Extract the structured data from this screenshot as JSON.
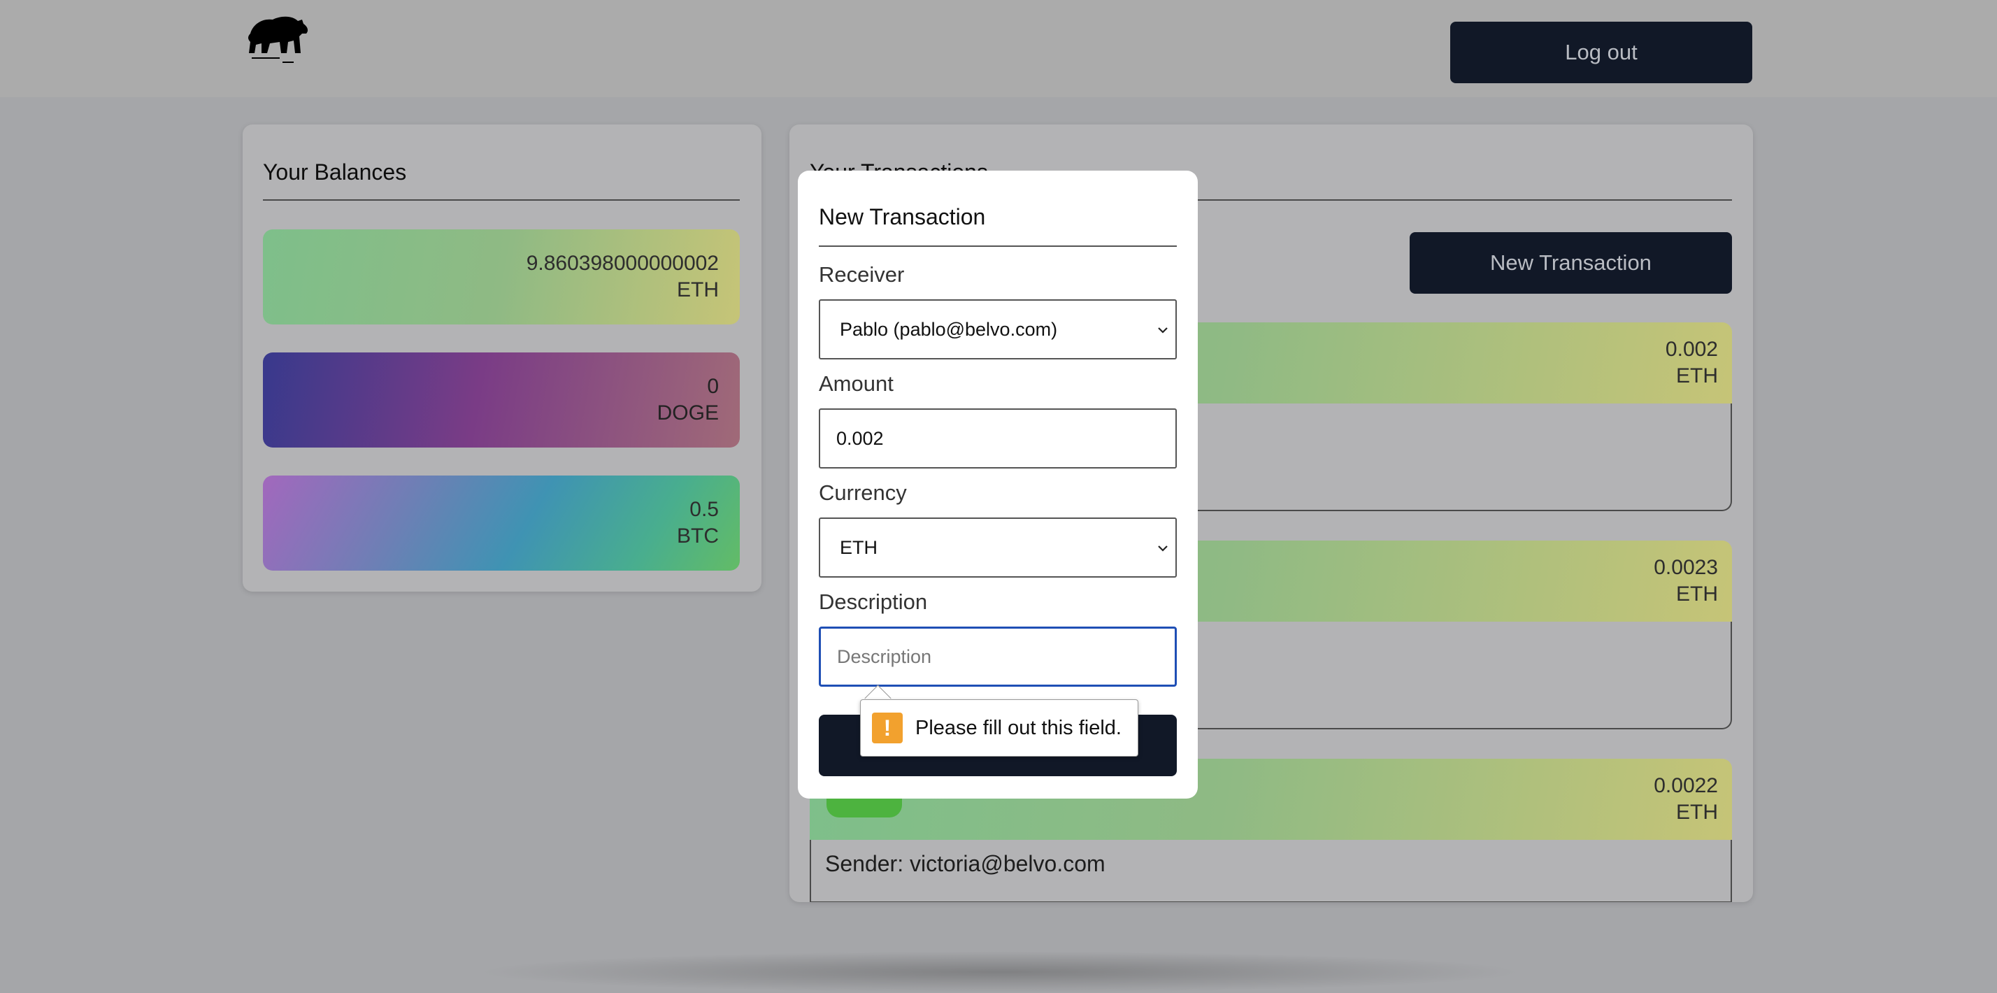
{
  "header": {
    "logo": "bear-logo",
    "logout_label": "Log out"
  },
  "balances": {
    "title": "Your Balances",
    "cards": [
      {
        "amount": "9.860398000000002",
        "currency": "ETH"
      },
      {
        "amount": "0",
        "currency": "DOGE"
      },
      {
        "amount": "0.5",
        "currency": "BTC"
      }
    ]
  },
  "transactions": {
    "title": "Your Transactions",
    "new_button_label": "New Transaction",
    "items": [
      {
        "amount": "0.002",
        "currency": "ETH"
      },
      {
        "amount": "0.0023",
        "currency": "ETH"
      },
      {
        "amount": "0.0022",
        "currency": "ETH",
        "sender_label": "Sender:",
        "sender": "victoria@belvo.com"
      }
    ]
  },
  "modal": {
    "title": "New Transaction",
    "receiver_label": "Receiver",
    "receiver_value": "Pablo (pablo@belvo.com)",
    "amount_label": "Amount",
    "amount_value": "0.002",
    "currency_label": "Currency",
    "currency_value": "ETH",
    "description_label": "Description",
    "description_placeholder": "Description",
    "validation_message": "Please fill out this field."
  },
  "colors": {
    "primary_button": "#111827",
    "focus_ring": "#1f4fb5",
    "warning": "#f2a12e"
  }
}
